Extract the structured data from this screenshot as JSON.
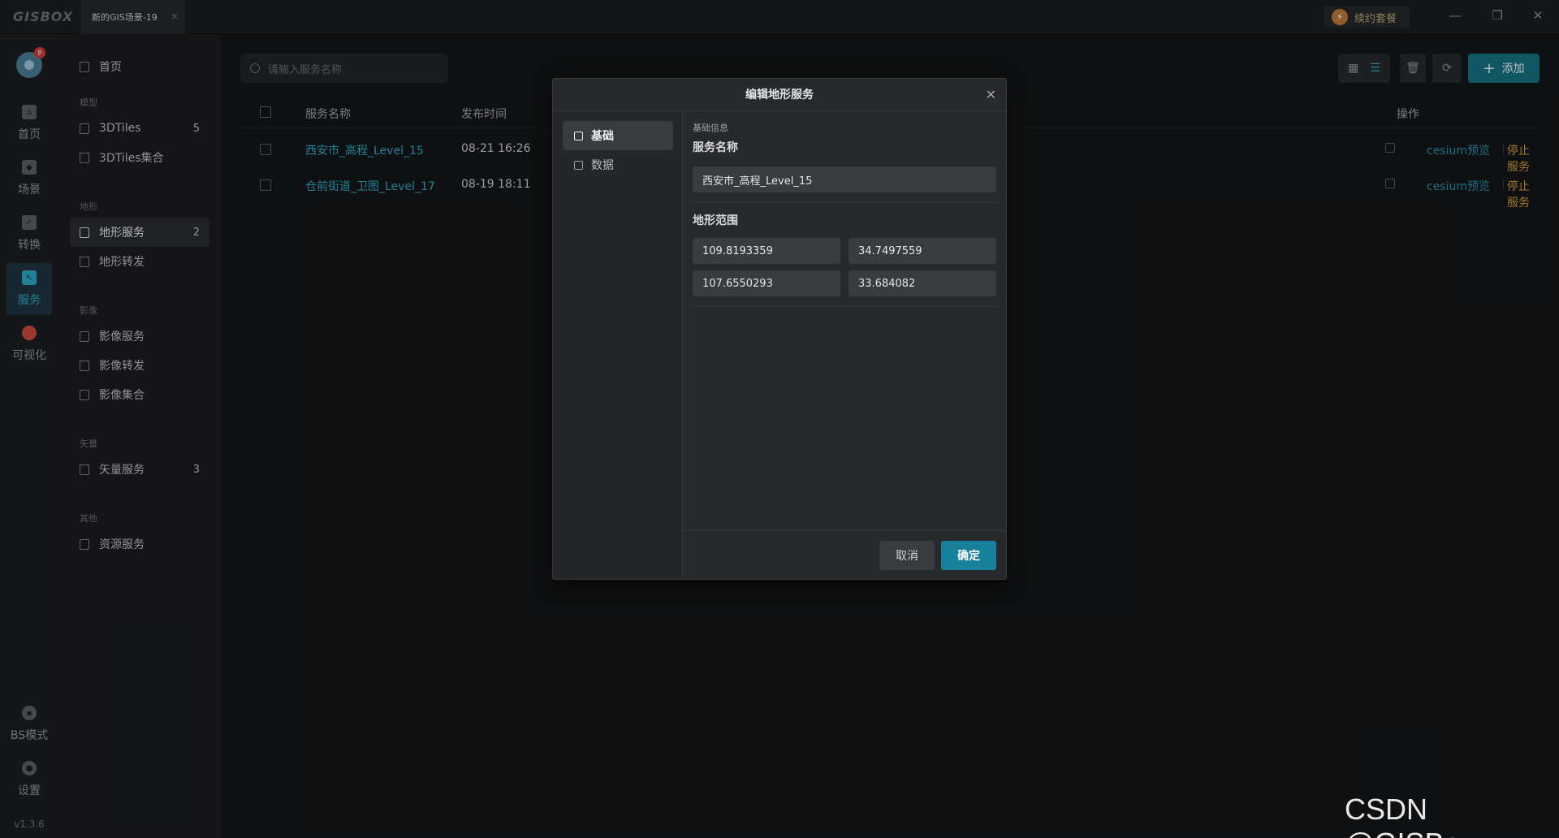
{
  "app": {
    "logo": "GISBOX",
    "tab_title": "新的GIS场景-19",
    "renew_label": "续约套餐",
    "version": "v1.3.6",
    "accent_color": "#2aa7c4",
    "warning_color": "#d09a3a"
  },
  "navbar": {
    "avatar_badge": "P",
    "items": [
      {
        "label": "首页",
        "icon": "home-icon"
      },
      {
        "label": "场景",
        "icon": "scene-icon"
      },
      {
        "label": "转换",
        "icon": "convert-icon"
      },
      {
        "label": "服务",
        "icon": "service-icon",
        "active": true
      },
      {
        "label": "可视化",
        "icon": "visualize-icon"
      },
      {
        "label": "BS模式",
        "icon": "lock-icon"
      },
      {
        "label": "设置",
        "icon": "gear-icon"
      }
    ]
  },
  "sidemenu": {
    "home": "首页",
    "groups": {
      "model": "模型",
      "terrain": "地形",
      "imagery": "影像",
      "vector": "矢量",
      "other": "其他"
    },
    "items": {
      "tiles3d": {
        "label": "3DTiles",
        "count": "5"
      },
      "tiles3d_set": {
        "label": "3DTiles集合"
      },
      "terrain_service": {
        "label": "地形服务",
        "count": "2"
      },
      "terrain_forward": {
        "label": "地形转发"
      },
      "imagery_service": {
        "label": "影像服务"
      },
      "imagery_forward": {
        "label": "影像转发"
      },
      "imagery_set": {
        "label": "影像集合"
      },
      "vector_service": {
        "label": "矢量服务",
        "count": "3"
      },
      "resource_service": {
        "label": "资源服务"
      }
    }
  },
  "main": {
    "search_placeholder": "请输入服务名称",
    "add_label": "添加",
    "columns": {
      "name": "服务名称",
      "time": "发布时间",
      "ops": "操作"
    },
    "rows": [
      {
        "name": "西安市_高程_Level_15",
        "time": "08-21 16:26",
        "preview": "cesium预览",
        "stop": "停止服务"
      },
      {
        "name": "仓前街道_卫图_Level_17",
        "time": "08-19 18:11",
        "preview": "cesium预览",
        "stop": "停止服务"
      }
    ]
  },
  "dialog": {
    "title": "编辑地形服务",
    "tabs": [
      {
        "label": "基础",
        "active": true
      },
      {
        "label": "数据"
      }
    ],
    "section": "基础信息",
    "name_label": "服务名称",
    "name_value": "西安市_高程_Level_15",
    "range_label": "地形范围",
    "range": {
      "x1": "109.8193359",
      "y1": "34.7497559",
      "x2": "107.6550293",
      "y2": "33.684082"
    },
    "cancel": "取消",
    "confirm": "确定"
  },
  "watermark": "CSDN @GISBox"
}
